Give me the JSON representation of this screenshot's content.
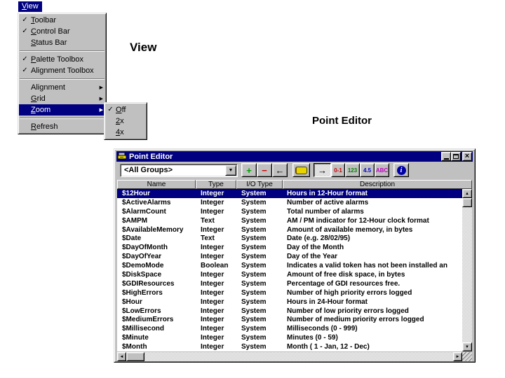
{
  "icons": {
    "check": "✓",
    "submenu_arrow": "▶",
    "dropdown_arrow": "▼",
    "scroll_up": "▲",
    "scroll_down": "▼",
    "scroll_left": "◄",
    "scroll_right": "►"
  },
  "colors": {
    "titlebar": "#000080",
    "selection": "#000080",
    "chrome": "#c0c0c0"
  },
  "menu_bar": {
    "view_label": "View",
    "view_mnemonic": "V"
  },
  "view_menu": {
    "items": [
      {
        "type": "item",
        "label": "Toolbar",
        "mnemonic": "T",
        "checked": true
      },
      {
        "type": "item",
        "label": "Control Bar",
        "mnemonic": "C",
        "checked": true
      },
      {
        "type": "item",
        "label": "Status Bar",
        "mnemonic": "S",
        "checked": false
      },
      {
        "type": "separator"
      },
      {
        "type": "item",
        "label": "Palette Toolbox",
        "mnemonic": "P",
        "checked": true
      },
      {
        "type": "item",
        "label": "Alignment Toolbox",
        "mnemonic": null,
        "checked": true
      },
      {
        "type": "separator"
      },
      {
        "type": "item",
        "label": "Alignment",
        "mnemonic": null,
        "submenu": true
      },
      {
        "type": "item",
        "label": "Grid",
        "mnemonic": "G",
        "submenu": true
      },
      {
        "type": "item",
        "label": "Zoom",
        "mnemonic": "Z",
        "submenu": true,
        "selected": true
      },
      {
        "type": "separator"
      },
      {
        "type": "item",
        "label": "Refresh",
        "mnemonic": "R"
      }
    ]
  },
  "zoom_submenu": {
    "items": [
      {
        "label": "Off",
        "mnemonic": "O",
        "checked": true
      },
      {
        "label": "2x",
        "mnemonic": "2",
        "checked": false
      },
      {
        "label": "4x",
        "mnemonic": "4",
        "checked": false
      }
    ]
  },
  "annotations": {
    "view_heading": "View",
    "point_editor_heading": "Point Editor"
  },
  "point_editor": {
    "title": "Point Editor",
    "window_controls": [
      {
        "name": "minimize"
      },
      {
        "name": "maximize"
      },
      {
        "name": "close"
      }
    ],
    "toolbar": {
      "group_filter_value": "<All Groups>",
      "buttons": [
        {
          "name": "add-point-button",
          "glyph": "+",
          "color": "#00a000"
        },
        {
          "name": "delete-point-button",
          "glyph": "−",
          "color": "#d00000"
        },
        {
          "name": "prev-point-button",
          "glyph": "←",
          "color": "#000000"
        },
        {
          "name": "database-button",
          "glyph": "db"
        },
        {
          "name": "next-point-button",
          "glyph": "→",
          "color": "#000000",
          "pressed": true
        },
        {
          "name": "filter-discrete-button",
          "glyph": "0-1",
          "color": "#d00000",
          "small": true
        },
        {
          "name": "filter-integer-button",
          "glyph": "123",
          "color": "#008000",
          "small": true
        },
        {
          "name": "filter-real-button",
          "glyph": "4.5",
          "color": "#0000d0",
          "small": true
        },
        {
          "name": "filter-text-button",
          "glyph": "ABC",
          "color": "#c000c0",
          "small": true
        },
        {
          "name": "info-button",
          "glyph": "i"
        }
      ]
    },
    "table": {
      "headers": [
        "Name",
        "Type",
        "I/O Type",
        "Description"
      ],
      "selected_row": 0,
      "rows": [
        [
          "$12Hour",
          "Integer",
          "System",
          "Hours in 12-Hour format"
        ],
        [
          "$ActiveAlarms",
          "Integer",
          "System",
          "Number of active alarms"
        ],
        [
          "$AlarmCount",
          "Integer",
          "System",
          "Total number of alarms"
        ],
        [
          "$AMPM",
          "Text",
          "System",
          "AM / PM indicator for 12-Hour clock format"
        ],
        [
          "$AvailableMemory",
          "Integer",
          "System",
          "Amount of available memory, in bytes"
        ],
        [
          "$Date",
          "Text",
          "System",
          "Date (e.g. 28/02/95)"
        ],
        [
          "$DayOfMonth",
          "Integer",
          "System",
          "Day of the Month"
        ],
        [
          "$DayOfYear",
          "Integer",
          "System",
          "Day of the Year"
        ],
        [
          "$DemoMode",
          "Boolean",
          "System",
          "Indicates a valid token has not been installed an"
        ],
        [
          "$DiskSpace",
          "Integer",
          "System",
          "Amount of free disk space, in bytes"
        ],
        [
          "$GDIResources",
          "Integer",
          "System",
          "Percentage of GDI resources free."
        ],
        [
          "$HighErrors",
          "Integer",
          "System",
          "Number of high priority errors logged"
        ],
        [
          "$Hour",
          "Integer",
          "System",
          "Hours in 24-Hour format"
        ],
        [
          "$LowErrors",
          "Integer",
          "System",
          "Number of low priority errors logged"
        ],
        [
          "$MediumErrors",
          "Integer",
          "System",
          "Number of medium priority errors logged"
        ],
        [
          "$Millisecond",
          "Integer",
          "System",
          "Milliseconds (0 - 999)"
        ],
        [
          "$Minute",
          "Integer",
          "System",
          "Minutes (0 - 59)"
        ],
        [
          "$Month",
          "Integer",
          "System",
          "Month ( 1 - Jan, 12 - Dec)"
        ]
      ]
    }
  }
}
